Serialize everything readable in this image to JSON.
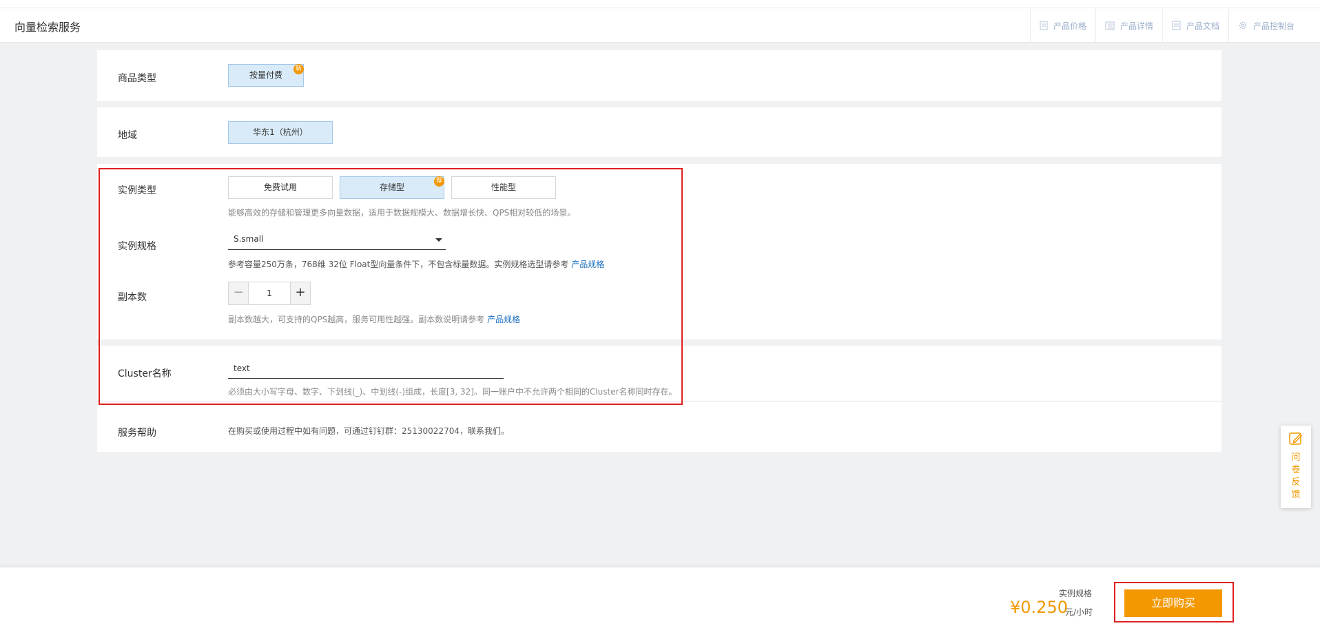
{
  "header": {
    "title": "向量检索服务",
    "links": [
      {
        "label": "产品价格",
        "icon": "price-doc-icon"
      },
      {
        "label": "产品详情",
        "icon": "detail-list-icon"
      },
      {
        "label": "产品文档",
        "icon": "document-icon"
      },
      {
        "label": "产品控制台",
        "icon": "gear-icon"
      }
    ]
  },
  "commodity": {
    "label": "商品类型",
    "option": "按量付费",
    "badge": "新"
  },
  "region": {
    "label": "地域",
    "option": "华东1（杭州）"
  },
  "instance_type": {
    "label": "实例类型",
    "options": [
      "免费试用",
      "存储型",
      "性能型"
    ],
    "selected_badge": "荐",
    "description": "能够高效的存储和管理更多向量数据，适用于数据规模大、数据增长快、QPS相对较低的场景。"
  },
  "instance_spec": {
    "label": "实例规格",
    "value": "S.small",
    "description": "参考容量250万条，768维 32位 Float型向量条件下，不包含标量数据。实例规格选型请参考",
    "link": "产品规格"
  },
  "replicas": {
    "label": "副本数",
    "value": "1",
    "minus": "−",
    "plus": "+",
    "description": "副本数越大，可支持的QPS越高，服务可用性越强。副本数说明请参考",
    "link": "产品规格"
  },
  "cluster": {
    "label": "Cluster名称",
    "value": "text",
    "description": "必须由大小写字母、数字、下划线(_)、中划线(-)组成，长度[3, 32]。同一账户中不允许两个相同的Cluster名称同时存在。"
  },
  "help": {
    "label": "服务帮助",
    "description": "在购买或使用过程中如有问题，可通过钉钉群：25130022704，联系我们。"
  },
  "feedback": {
    "label": "问卷反馈",
    "icon": "edit-icon"
  },
  "footer": {
    "price_label": "实例规格",
    "price": "¥0.250",
    "unit": "元/小时",
    "buy_label": "立即购买"
  },
  "colors": {
    "accent": "#f39800",
    "link": "#1a6fc0",
    "highlight_border": "#e02020",
    "selected_bg": "#d9ebf9"
  }
}
